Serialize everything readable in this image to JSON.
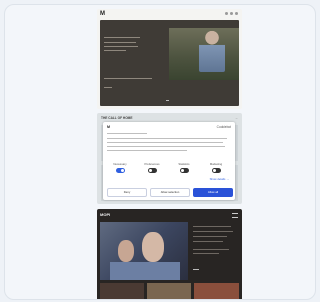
{
  "colors": {
    "page_bg": "#eef2f7",
    "hero_dark": "#3f3b36",
    "dialog_accent": "#2a52d8",
    "toggle_on": "#2f5fe0"
  },
  "tiles": [
    {
      "name": "tile-1",
      "logo": "M"
    },
    {
      "name": "tile-2",
      "heading": "THE CALL OF HOME",
      "more": "→"
    },
    {
      "name": "tile-3",
      "logo": "MOPI"
    }
  ],
  "consent": {
    "title": "M",
    "brand": "Cookiebot",
    "toggles": [
      {
        "label": "Necessary",
        "on": true
      },
      {
        "label": "Preferences",
        "on": false
      },
      {
        "label": "Statistics",
        "on": false
      },
      {
        "label": "Marketing",
        "on": false
      }
    ],
    "details_link": "Show details →",
    "buttons": {
      "deny": "Deny",
      "allow_selection": "Allow selection",
      "allow_all": "Allow all"
    }
  }
}
